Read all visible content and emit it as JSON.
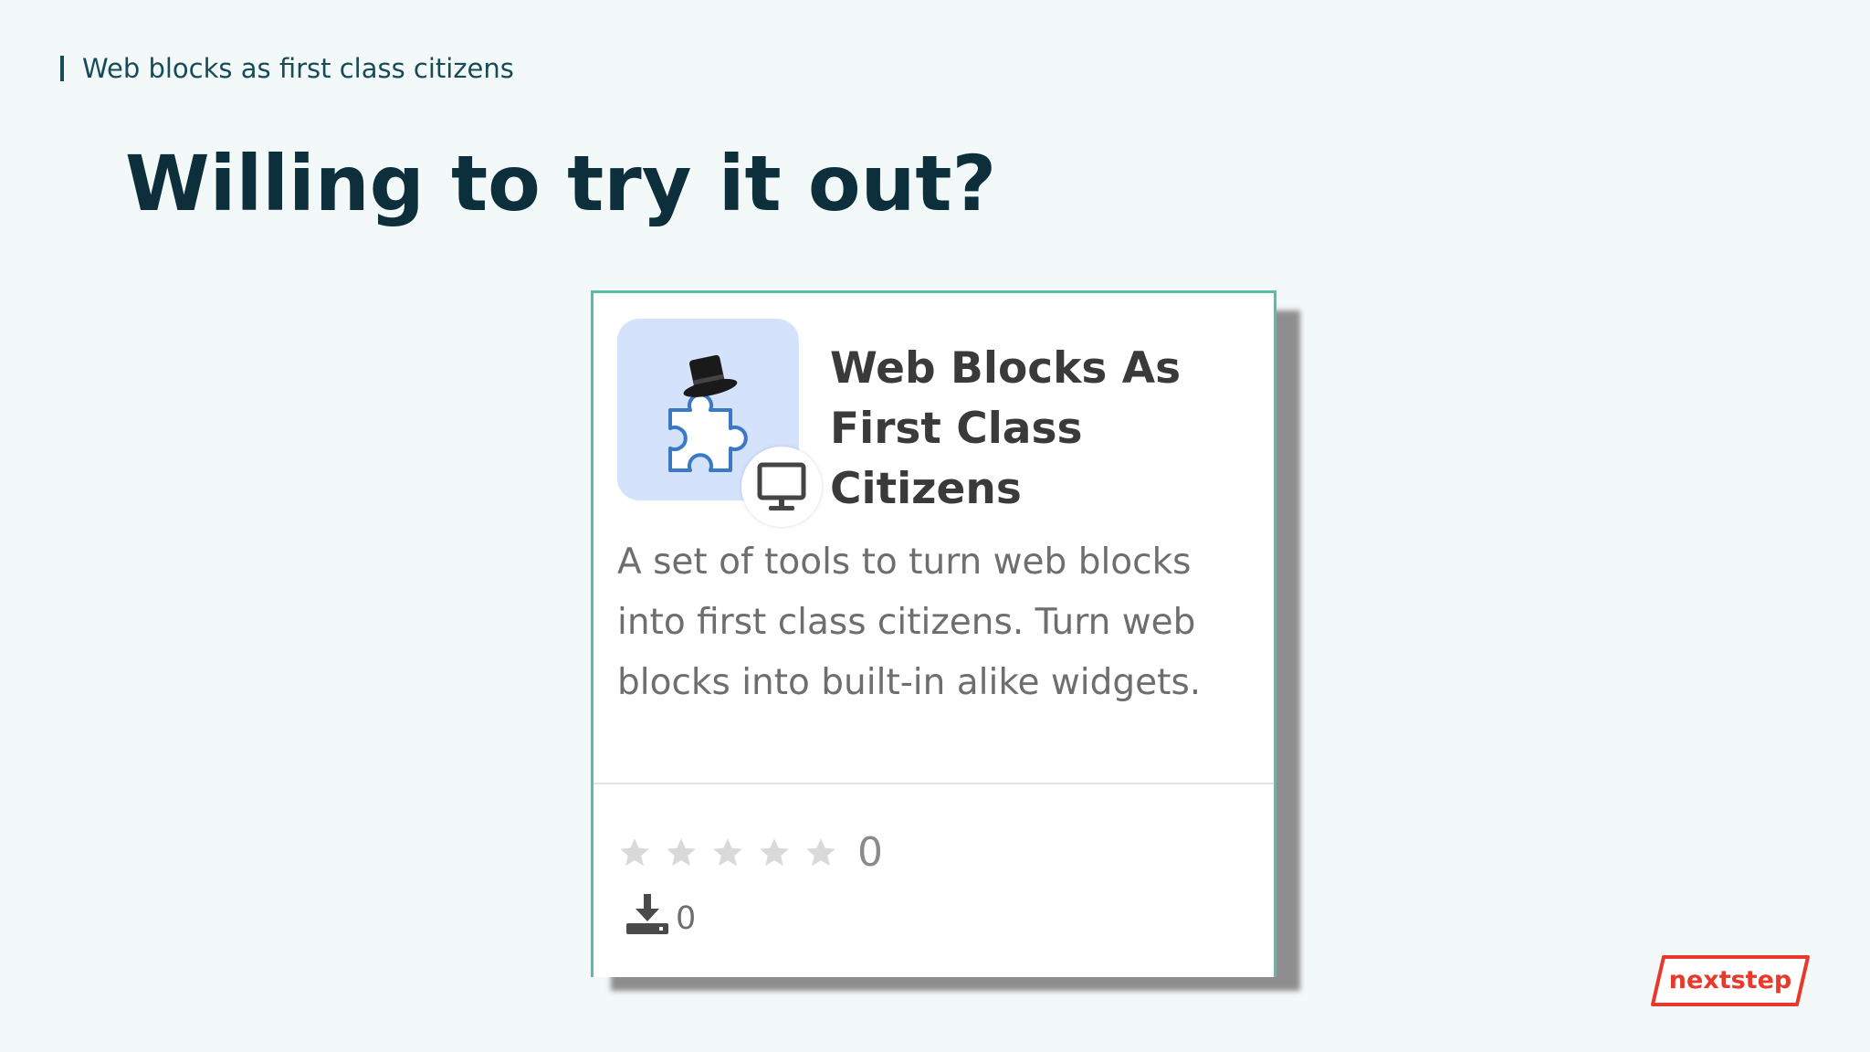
{
  "header": {
    "breadcrumb": "Web blocks as first class citizens",
    "title": "Willing to try it out?"
  },
  "card": {
    "title": "Web Blocks As First Class Citizens",
    "description": "A set of tools to turn web blocks into first class citizens. Turn web blocks into built-in alike widgets.",
    "icon": "puzzle-top-hat-icon",
    "platform_badge_icon": "monitor-icon",
    "rating": {
      "stars_filled": 0,
      "stars_total": 5,
      "count": "0"
    },
    "downloads": {
      "icon": "download-icon",
      "count": "0"
    }
  },
  "logo": {
    "text": "nextstep",
    "color": "#e8392b"
  },
  "colors": {
    "background": "#f3f9f8",
    "title": "#0c2f3b",
    "breadcrumb": "#164b5a",
    "card_border": "#5cbcaa",
    "icon_bg": "#d4e3fb"
  }
}
